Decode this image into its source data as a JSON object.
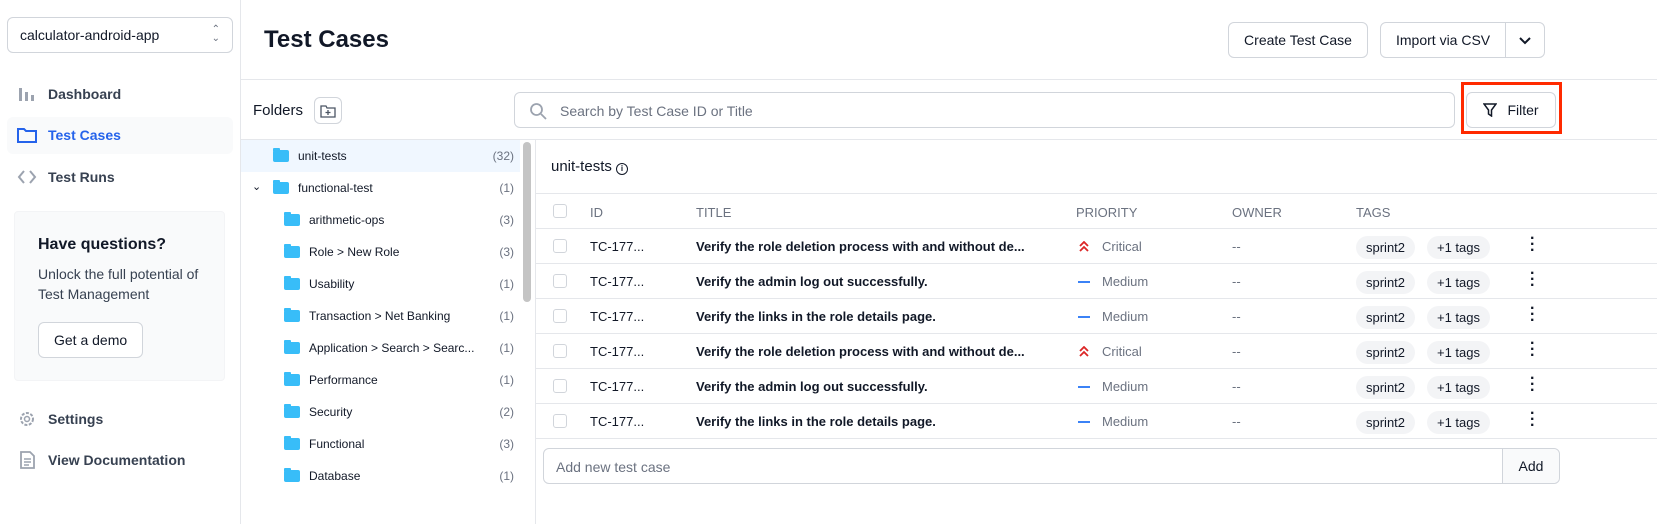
{
  "sidebar": {
    "project": "calculator-android-app",
    "nav": [
      {
        "label": "Dashboard",
        "icon": "bar-chart-icon"
      },
      {
        "label": "Test Cases",
        "icon": "folder-icon",
        "active": true
      },
      {
        "label": "Test Runs",
        "icon": "code-icon"
      }
    ],
    "promo": {
      "title": "Have questions?",
      "text": "Unlock the full potential of Test Management",
      "button": "Get a demo"
    },
    "bottom": [
      {
        "label": "Settings",
        "icon": "gear-icon"
      },
      {
        "label": "View Documentation",
        "icon": "document-icon"
      }
    ]
  },
  "header": {
    "title": "Test Cases",
    "create": "Create Test Case",
    "import": "Import via CSV"
  },
  "toolbar": {
    "folders": "Folders",
    "search_placeholder": "Search by Test Case ID or Title",
    "filter": "Filter"
  },
  "folders": [
    {
      "name": "unit-tests",
      "count": "(32)"
    },
    {
      "name": "functional-test",
      "count": "(1)"
    },
    {
      "name": "arithmetic-ops",
      "count": "(3)"
    },
    {
      "name": "Role > New Role",
      "count": "(3)"
    },
    {
      "name": "Usability",
      "count": "(1)"
    },
    {
      "name": "Transaction > Net Banking",
      "count": "(1)"
    },
    {
      "name": "Application > Search > Searc...",
      "count": "(1)"
    },
    {
      "name": "Performance",
      "count": "(1)"
    },
    {
      "name": "Security",
      "count": "(2)"
    },
    {
      "name": "Functional",
      "count": "(3)"
    },
    {
      "name": "Database",
      "count": "(1)"
    }
  ],
  "main": {
    "folder_title": "unit-tests",
    "columns": {
      "id": "ID",
      "title": "TITLE",
      "priority": "PRIORITY",
      "owner": "OWNER",
      "tags": "TAGS"
    },
    "rows": [
      {
        "id": "TC-177...",
        "title": "Verify the role deletion process with and without de...",
        "priority": "Critical",
        "owner": "--",
        "tag": "sprint2",
        "more": "+1 tags"
      },
      {
        "id": "TC-177...",
        "title": "Verify the admin log out successfully.",
        "priority": "Medium",
        "owner": "--",
        "tag": "sprint2",
        "more": "+1 tags"
      },
      {
        "id": "TC-177...",
        "title": "Verify the links in the role details page.",
        "priority": "Medium",
        "owner": "--",
        "tag": "sprint2",
        "more": "+1 tags"
      },
      {
        "id": "TC-177...",
        "title": "Verify the role deletion process with and without de...",
        "priority": "Critical",
        "owner": "--",
        "tag": "sprint2",
        "more": "+1 tags"
      },
      {
        "id": "TC-177...",
        "title": "Verify the admin log out successfully.",
        "priority": "Medium",
        "owner": "--",
        "tag": "sprint2",
        "more": "+1 tags"
      },
      {
        "id": "TC-177...",
        "title": "Verify the links in the role details page.",
        "priority": "Medium",
        "owner": "--",
        "tag": "sprint2",
        "more": "+1 tags"
      }
    ],
    "add_placeholder": "Add new test case",
    "add_button": "Add"
  },
  "colors": {
    "accent": "#2563eb",
    "critical": "#dc2626",
    "medium": "#3b82f6",
    "folder": "#38bdf8",
    "highlight": "#ff2a00"
  }
}
